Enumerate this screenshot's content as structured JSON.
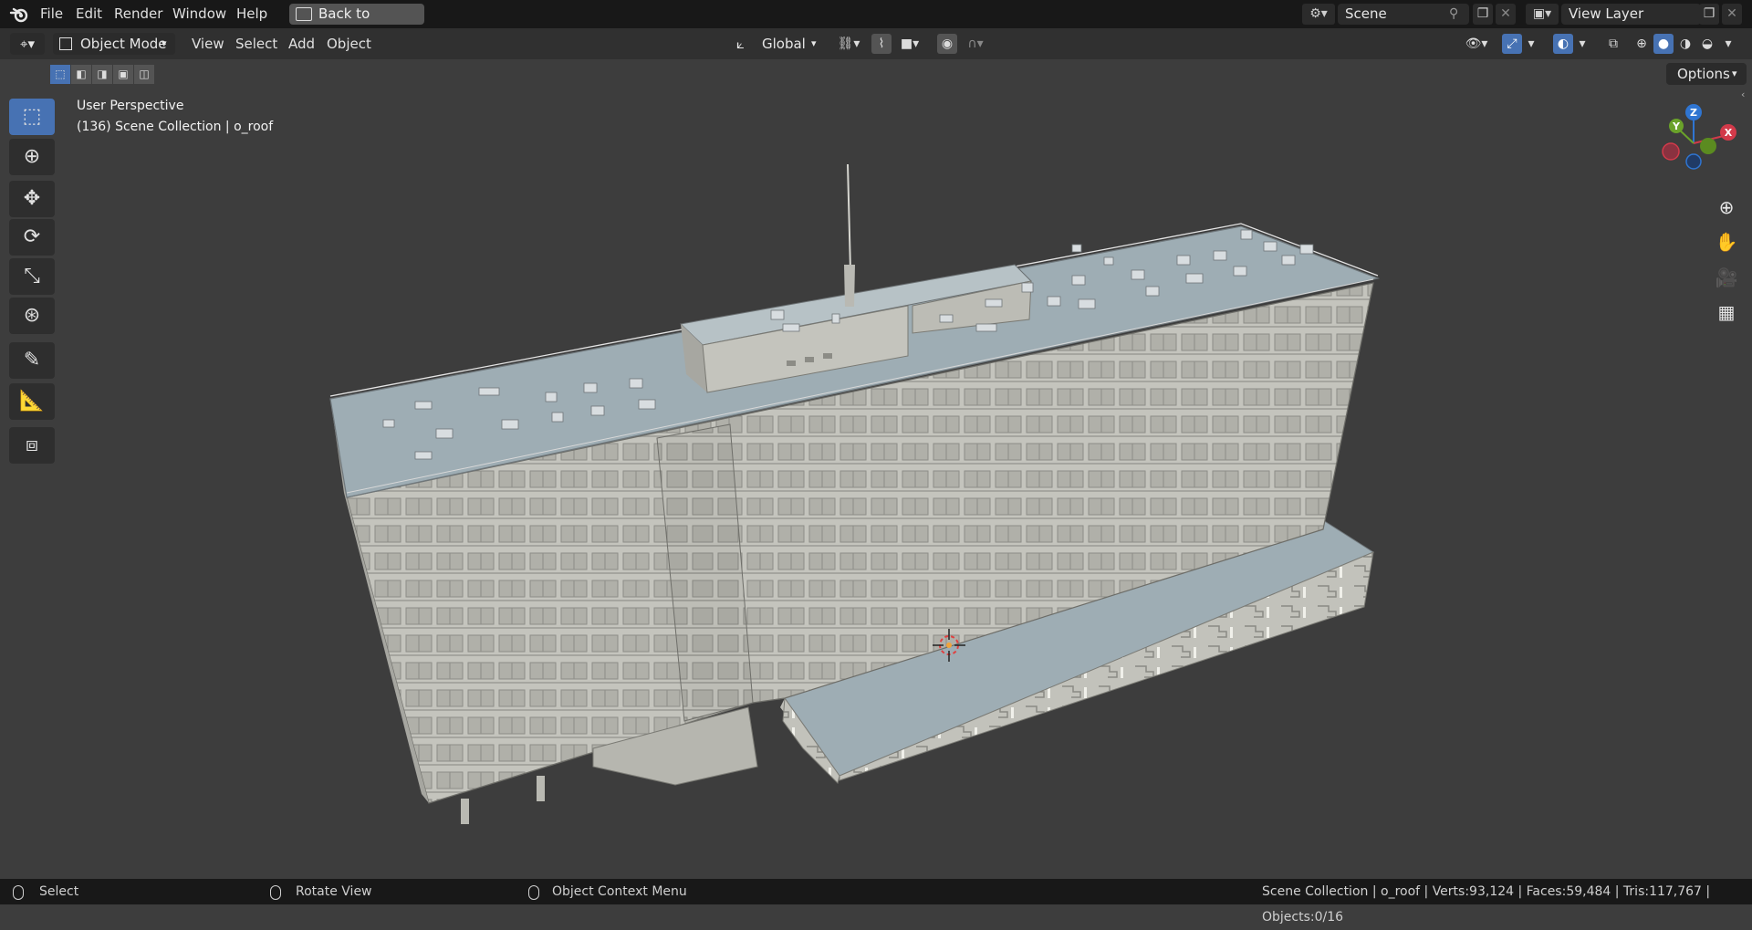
{
  "menu": {
    "file": "File",
    "edit": "Edit",
    "render": "Render",
    "window": "Window",
    "help": "Help",
    "back_button": "Back to Previous"
  },
  "scene": {
    "name": "Scene"
  },
  "view_layer": {
    "name": "View Layer"
  },
  "header": {
    "mode": "Object Mode",
    "view": "View",
    "select": "Select",
    "add": "Add",
    "object": "Object",
    "orientation": "Global"
  },
  "options_label": "Options",
  "viewport": {
    "perspective": "User Perspective",
    "collection": "(136) Scene Collection | o_roof"
  },
  "gizmo": {
    "z": "Z",
    "y": "Y",
    "x": "X"
  },
  "statusbar": {
    "select": "Select",
    "rotate": "Rotate View",
    "context": "Object Context Menu",
    "stats": "Scene Collection | o_roof | Verts:93,124 | Faces:59,484 | Tris:117,767 | Objects:0/16"
  },
  "colors": {
    "active_tool": "#4772b3",
    "viewport_bg": "#3d3d3d",
    "building_wall": "#c8c8c2",
    "roof": "#9aa9b1"
  },
  "icons": [
    "blender-logo-icon",
    "select-box-icon",
    "cursor-icon",
    "move-icon",
    "rotate-icon",
    "scale-icon",
    "transform-icon",
    "annotate-icon",
    "measure-icon",
    "add-cube-icon",
    "zoom-icon",
    "hand-icon",
    "camera-icon",
    "grid-icon"
  ]
}
